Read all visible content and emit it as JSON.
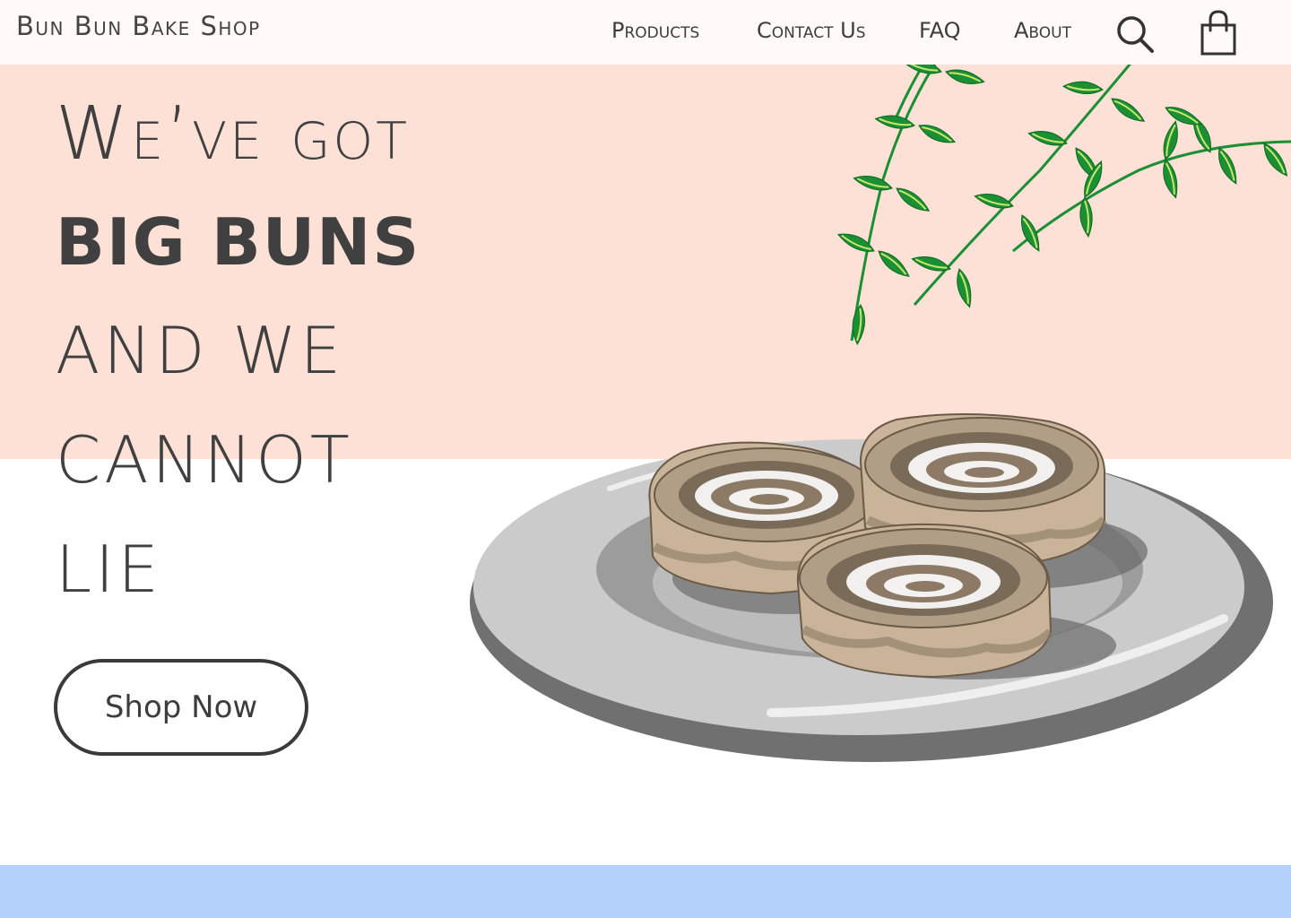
{
  "brand": {
    "name": "Bun Bun Bake Shop"
  },
  "nav": {
    "products": "Products",
    "contact": "Contact Us",
    "faq": "FAQ",
    "about": "About",
    "search_icon": "search-icon",
    "cart_icon": "shopping-bag-icon"
  },
  "hero": {
    "line1": "We’ve got",
    "line2": "BIG BUNS",
    "line3": "AND WE",
    "line4": "CANNOT",
    "line5": "LIE",
    "cta": "Shop Now"
  },
  "colors": {
    "hero_band": "#fde0d6",
    "footer_band": "#b3d1fa",
    "text": "#444444",
    "leaf": "#1e9b3c"
  }
}
